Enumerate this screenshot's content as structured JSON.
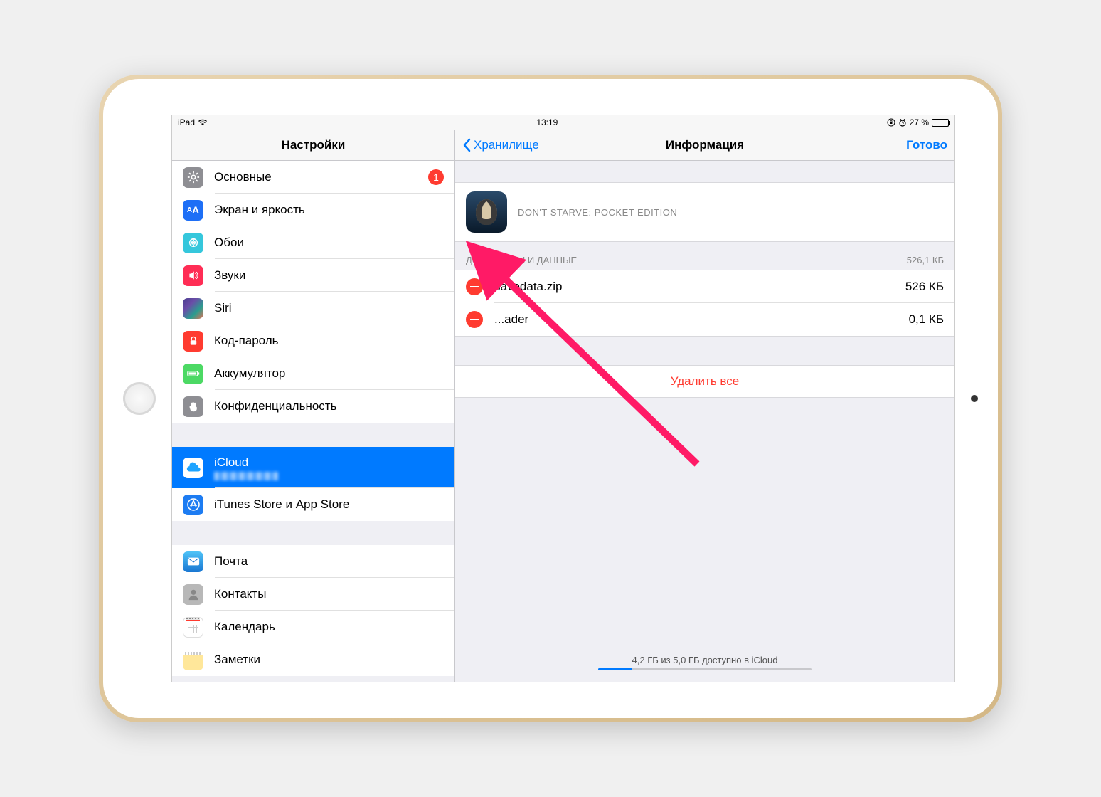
{
  "status_bar": {
    "device": "iPad",
    "time": "13:19",
    "battery_pct": "27 %"
  },
  "sidebar": {
    "title": "Настройки",
    "items": [
      {
        "label": "Основные",
        "badge": "1"
      },
      {
        "label": "Экран и яркость"
      },
      {
        "label": "Обои"
      },
      {
        "label": "Звуки"
      },
      {
        "label": "Siri"
      },
      {
        "label": "Код-пароль"
      },
      {
        "label": "Аккумулятор"
      },
      {
        "label": "Конфиденциальность"
      },
      {
        "label": "iCloud"
      },
      {
        "label": "iTunes Store и App Store"
      },
      {
        "label": "Почта"
      },
      {
        "label": "Контакты"
      },
      {
        "label": "Календарь"
      },
      {
        "label": "Заметки"
      }
    ]
  },
  "detail": {
    "back_label": "Хранилище",
    "title": "Информация",
    "done_label": "Готово",
    "app_name": "DON'T STARVE: POCKET EDITION",
    "section_title": "ДОКУМЕНТЫ И ДАННЫЕ",
    "section_size": "526,1 КБ",
    "files": [
      {
        "name": "savedata.zip",
        "size": "526 КБ"
      },
      {
        "name": "...ader",
        "size": "0,1 КБ"
      }
    ],
    "delete_all_label": "Удалить все",
    "footer_text": "4,2 ГБ из 5,0 ГБ доступно в iCloud"
  }
}
